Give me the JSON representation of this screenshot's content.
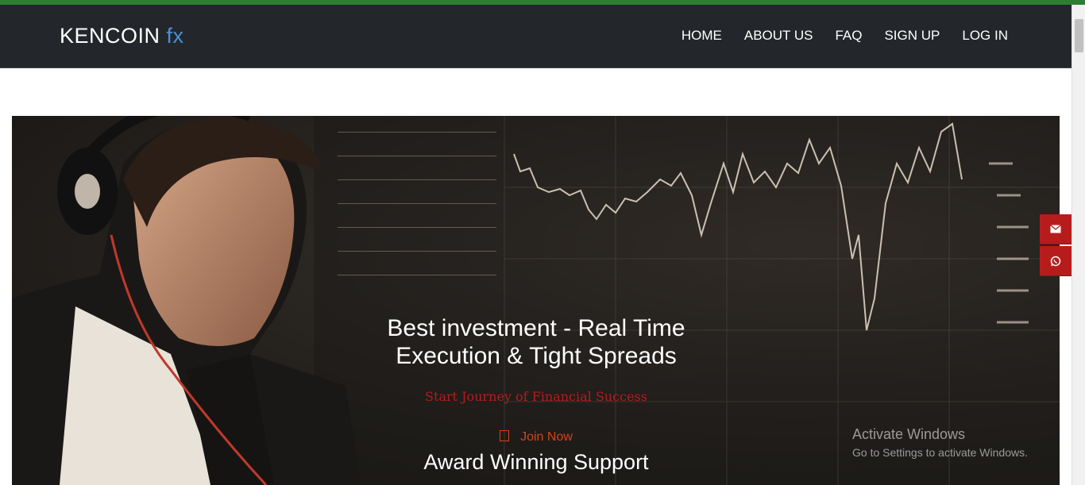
{
  "brand": {
    "name": "KENCOIN",
    "suffix": "fx"
  },
  "nav": {
    "items": [
      "HOME",
      "ABOUT US",
      "FAQ",
      "SIGN UP",
      "LOG IN"
    ]
  },
  "hero": {
    "headline": "Best investment - Real Time Execution & Tight Spreads",
    "subline": "Start Journey of Financial Success",
    "join_label": "Join Now",
    "award": "Award Winning Support"
  },
  "contact": {
    "email_icon": "envelope-icon",
    "whatsapp_icon": "whatsapp-icon"
  },
  "watermark": {
    "line1": "Activate Windows",
    "line2": "Go to Settings to activate Windows."
  },
  "colors": {
    "accent_blue": "#4a90d9",
    "nav_bg": "#23272b",
    "cta_red": "#b71c1c",
    "top_stripe": "#2e7d32"
  }
}
